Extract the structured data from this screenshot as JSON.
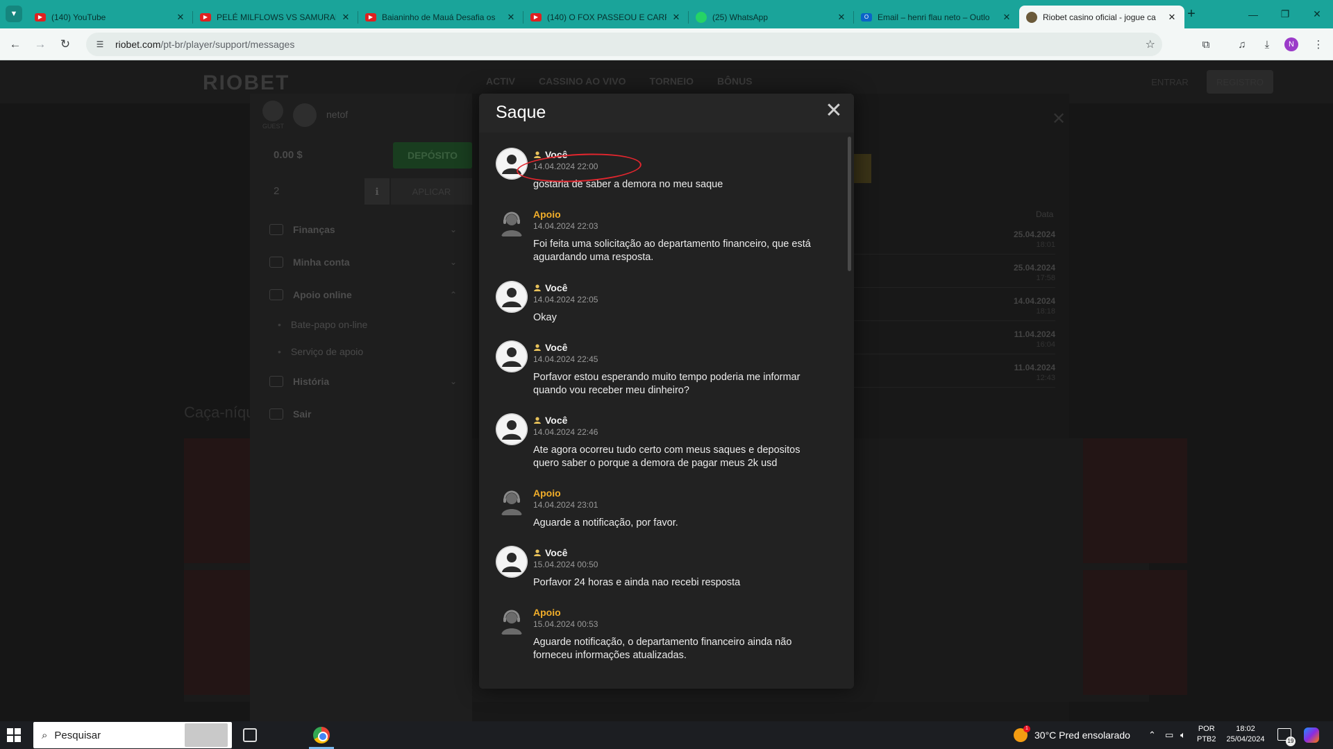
{
  "browser": {
    "tabs": [
      {
        "title": "(140) YouTube",
        "icon": "youtube-icon"
      },
      {
        "title": "PELÉ MILFLOWS VS SAMURAI |",
        "icon": "youtube-icon"
      },
      {
        "title": "Baianinho de Mauá Desafia os",
        "icon": "youtube-icon"
      },
      {
        "title": "(140) O FOX PASSEOU E CARRE",
        "icon": "youtube-icon"
      },
      {
        "title": "(25) WhatsApp",
        "icon": "whatsapp-icon"
      },
      {
        "title": "Email – henri flau neto – Outlo",
        "icon": "outlook-icon"
      },
      {
        "title": "Riobet casino oficial - jogue ca",
        "icon": "riobet-icon"
      }
    ],
    "url_host": "riobet.com",
    "url_path": "/pt-br/player/support/messages",
    "profile_initial": "N"
  },
  "site": {
    "logo": "RIOBET",
    "nav": [
      "ACTIV",
      "CASSINO AO VIVO",
      "TORNEIO",
      "BÔNUS"
    ],
    "header_buttons": [
      "ENTRAR",
      "REGISTRO"
    ]
  },
  "sidebar": {
    "guest_label": "GUEST",
    "username": "netof",
    "balance": "0.00 $",
    "deposit_label": "DEPÓSITO",
    "bonus_count": "2",
    "apply_label": "APLICAR",
    "menu": [
      {
        "label": "Finanças",
        "chevron": "down"
      },
      {
        "label": "Minha conta",
        "chevron": "down"
      },
      {
        "label": "Apoio online",
        "chevron": "up"
      }
    ],
    "submenu": [
      "Bate-papo on-line",
      "Serviço de apoio"
    ],
    "menu_bottom": [
      {
        "label": "História",
        "chevron": "down"
      },
      {
        "label": "Sair",
        "chevron": ""
      }
    ]
  },
  "background": {
    "date_header": "Data",
    "rows": [
      {
        "date": "25.04.2024",
        "time": "18:01"
      },
      {
        "date": "25.04.2024",
        "time": "17:58"
      },
      {
        "date": "14.04.2024",
        "time": "18:18"
      },
      {
        "date": "11.04.2024",
        "time": "16:04"
      },
      {
        "date": "11.04.2024",
        "time": "12:43"
      }
    ],
    "left_text": "Caça-níqu"
  },
  "modal": {
    "title": "Saque",
    "close_glyph": "✕",
    "messages": [
      {
        "author": "Você",
        "role": "user",
        "time": "14.04.2024 22:00",
        "text": "gostaria de saber a demora no meu saque"
      },
      {
        "author": "Apoio",
        "role": "support",
        "time": "14.04.2024 22:03",
        "text": "Foi feita uma solicitação ao departamento financeiro, que está aguardando uma resposta."
      },
      {
        "author": "Você",
        "role": "user",
        "time": "14.04.2024 22:05",
        "text": "Okay"
      },
      {
        "author": "Você",
        "role": "user",
        "time": "14.04.2024 22:45",
        "text": "Porfavor estou esperando muito tempo poderia me informar quando vou receber meu dinheiro?"
      },
      {
        "author": "Você",
        "role": "user",
        "time": "14.04.2024 22:46",
        "text": "Ate agora ocorreu tudo certo com meus saques e depositos quero saber o porque a demora de pagar meus 2k usd"
      },
      {
        "author": "Apoio",
        "role": "support",
        "time": "14.04.2024 23:01",
        "text": "Aguarde a notificação, por favor."
      },
      {
        "author": "Você",
        "role": "user",
        "time": "15.04.2024 00:50",
        "text": "Porfavor 24 horas e ainda nao recebi resposta"
      },
      {
        "author": "Apoio",
        "role": "support",
        "time": "15.04.2024 00:53",
        "text": "Aguarde notificação, o departamento financeiro ainda não forneceu informações atualizadas."
      }
    ]
  },
  "taskbar": {
    "search_placeholder": "Pesquisar",
    "weather": "30°C  Pred ensolarado",
    "weather_badge": "1",
    "lang_line1": "POR",
    "lang_line2": "PTB2",
    "time": "18:02",
    "date": "25/04/2024",
    "notification_count": "19"
  },
  "colors": {
    "tabbar": "#1aa49a",
    "support_author": "#f0ad2a",
    "annotation": "#e3262e",
    "modal_bg": "#222222"
  }
}
